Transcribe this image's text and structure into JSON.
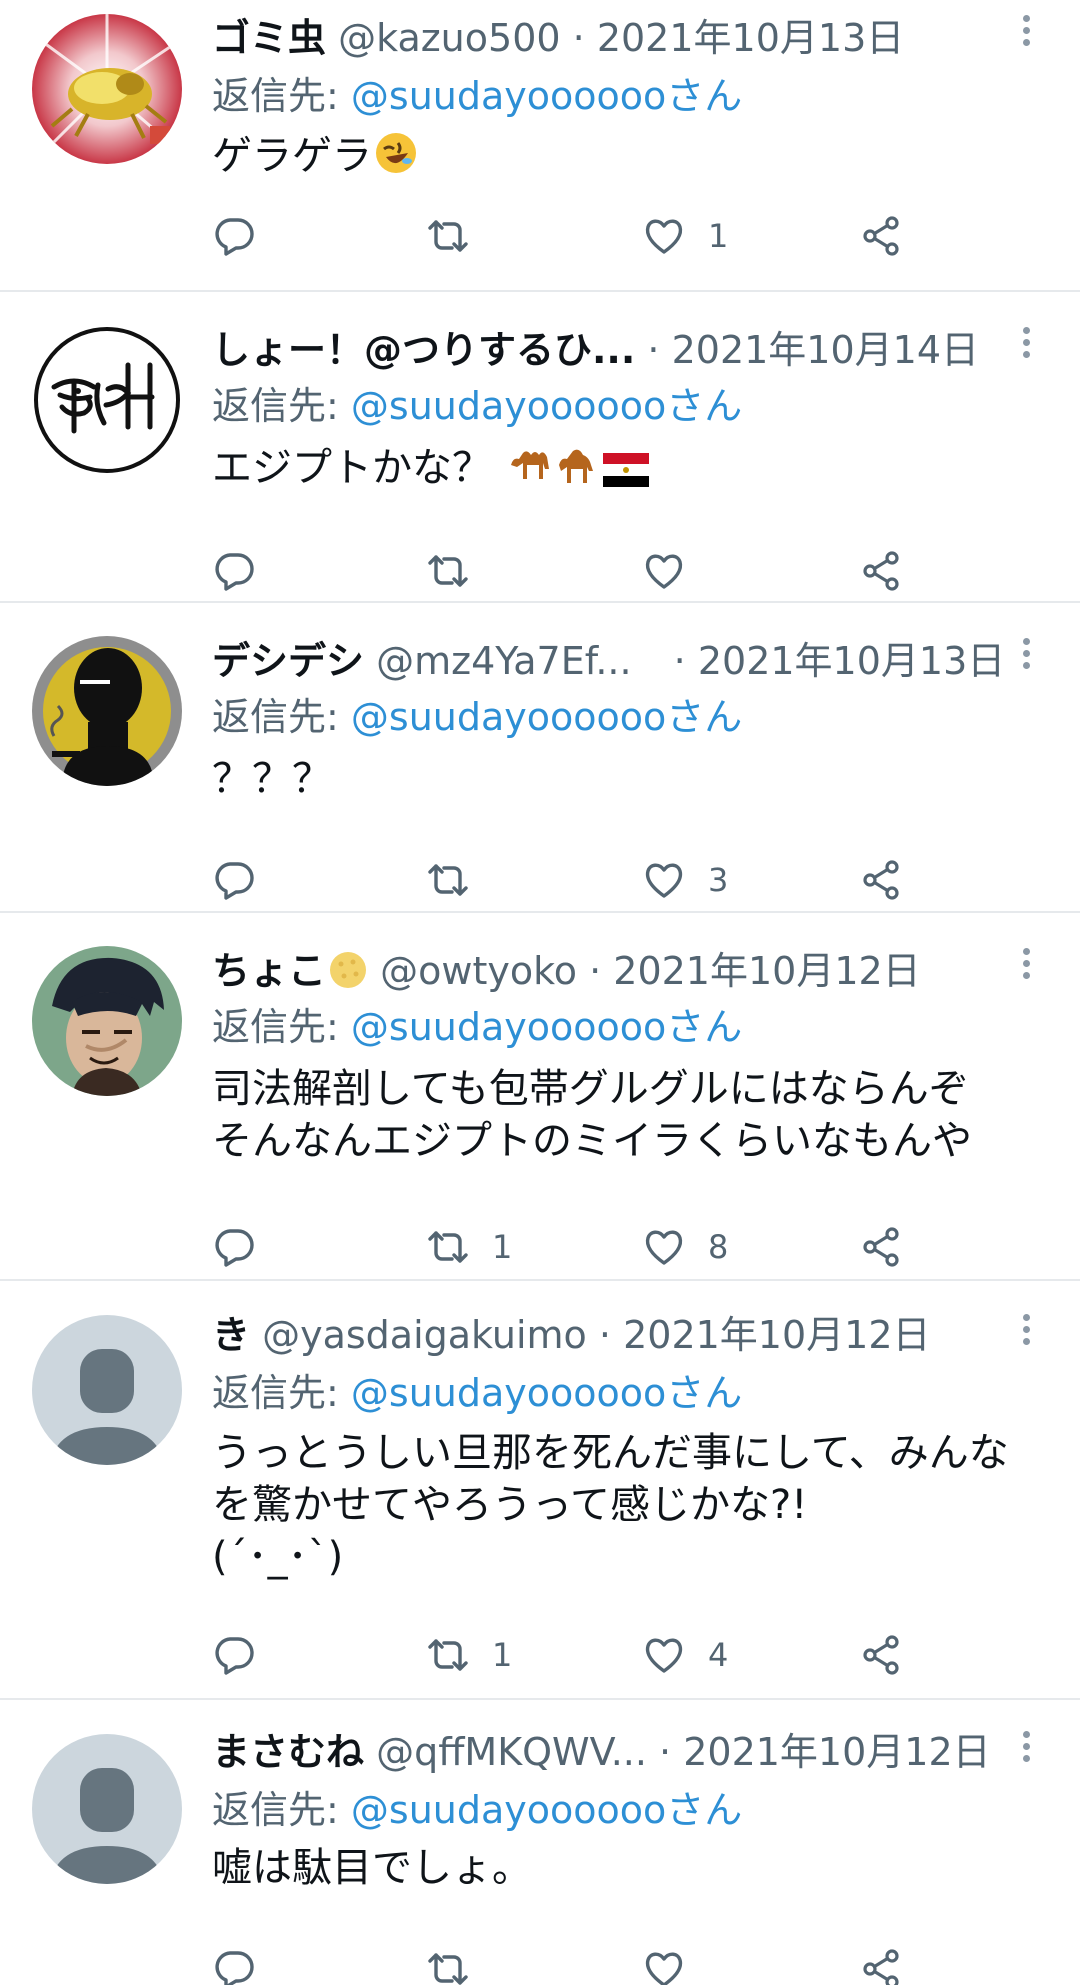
{
  "tweets": [
    {
      "name": "ゴミ虫",
      "name_emoji": "",
      "handle": "@kazuo500",
      "separator": "·",
      "date": "2021年10月13日",
      "reply_prefix": "返信先: ",
      "reply_to": "@suudayooooooさん",
      "text_lines": [
        "ゲラゲラ"
      ],
      "text_emoji": "rolling-on-floor-laughing",
      "retweets": "",
      "likes": "1",
      "avatar": "golden-beetle-avatar"
    },
    {
      "name": "しょー！@つりするひ...",
      "name_emoji": "",
      "handle": "",
      "separator": "·",
      "date": "2021年10月14日",
      "reply_prefix": "返信先: ",
      "reply_to": "@suudayooooooさん",
      "text_lines": [
        "エジプトかな？"
      ],
      "text_emoji": "camels-and-egypt-flag",
      "retweets": "",
      "likes": "",
      "avatar": "handwritten-logo-avatar"
    },
    {
      "name": "デシデシ",
      "name_emoji": "",
      "handle": "@mz4Ya7Ef...",
      "separator": "·",
      "date": "2021年10月13日",
      "reply_prefix": "返信先: ",
      "reply_to": "@suudayooooooさん",
      "text_lines": [
        "？？？"
      ],
      "text_emoji": "",
      "retweets": "",
      "likes": "3",
      "avatar": "silhouette-smoking-avatar"
    },
    {
      "name": "ちょこ",
      "name_emoji": "cookie",
      "handle": "@owtyoko",
      "separator": "·",
      "date": "2021年10月12日",
      "reply_prefix": "返信先: ",
      "reply_to": "@suudayooooooさん",
      "text_lines": [
        "司法解剖しても包帯グルグルにはならんぞ",
        "そんなんエジプトのミイラくらいなもんや"
      ],
      "text_emoji": "",
      "retweets": "1",
      "likes": "8",
      "avatar": "anime-character-avatar"
    },
    {
      "name": "き",
      "name_emoji": "",
      "handle": "@yasdaigakuimo",
      "separator": "·",
      "date": "2021年10月12日",
      "reply_prefix": "返信先: ",
      "reply_to": "@suudayooooooさん",
      "text_lines": [
        "うっとうしい旦那を死んだ事にして、みんな",
        "を驚かせてやろうって感じかな?!",
        "(´･_･`)"
      ],
      "text_emoji": "",
      "retweets": "1",
      "likes": "4",
      "avatar": "default-person-avatar"
    },
    {
      "name": "まさむね",
      "name_emoji": "",
      "handle": "@qffMKQWV...",
      "separator": "·",
      "date": "2021年10月12日",
      "reply_prefix": "返信先: ",
      "reply_to": "@suudayooooooさん",
      "text_lines": [
        "嘘は駄目でしょ。"
      ],
      "text_emoji": "",
      "retweets": "",
      "likes": "",
      "avatar": "default-person-avatar"
    }
  ],
  "colors": {
    "link": "#2d8fd5",
    "secondary_text": "#536471",
    "divider": "#e6e9ec",
    "icon": "#536471"
  }
}
